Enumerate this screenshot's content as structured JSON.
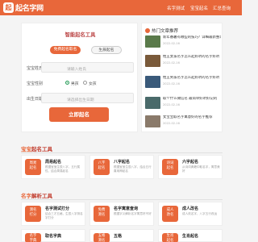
{
  "header": {
    "logo_mark": "起",
    "logo_text": "起名字网",
    "nav": [
      "名字测试",
      "宝宝起名",
      "汇总查询"
    ]
  },
  "form": {
    "title": "智能起名工具",
    "tabs": [
      {
        "label": "免费起名取名",
        "active": true
      },
      {
        "label": "生辰起名",
        "active": false
      }
    ],
    "surname_label": "宝宝姓氏",
    "surname_placeholder": "请输入姓氏",
    "gender_label": "宝宝性别",
    "gender_options": [
      {
        "label": "男孩",
        "selected": true
      },
      {
        "label": "女孩",
        "selected": false
      }
    ],
    "birth_label": "出生日期",
    "birth_placeholder": "请选择出生日期",
    "submit": "立即起名"
  },
  "news": {
    "title": "热门文章推荐",
    "items": [
      {
        "title": "新年番薯有哪些的技巧？详细最新整理",
        "date": "2022-02-16",
        "thumb_color": "#5a7a4a"
      },
      {
        "title": "姓王女孩名字怎么起好听的名字好听",
        "date": "2022-02-16",
        "thumb_color": "#7a5a3a"
      },
      {
        "title": "姓王男孩名字怎么起好听的名字好听",
        "date": "2022-02-16",
        "thumb_color": "#3a5a7a"
      },
      {
        "title": "取个什么微信名 最简单好听好记的",
        "date": "2022-02-16",
        "thumb_color": "#4a6a6a"
      },
      {
        "title": "女宝宝取名字寓意好的名字推荐",
        "date": "2022-02-16",
        "thumb_color": "#8a7a6a"
      }
    ]
  },
  "sections": [
    {
      "title_accent": "宝宝",
      "title_rest": "起名工具",
      "cards": [
        {
          "icon": "周易\n起名",
          "title": "周易起名",
          "desc": "根据宝宝生辰八字，五行属性，结合周易起名",
          "color": "#e8673a"
        },
        {
          "icon": "八字\n起名",
          "title": "八字起名",
          "desc": "根据宝宝生辰八字，结合五行喜用神起名",
          "color": "#e8673a"
        },
        {
          "icon": "诗词\n起名",
          "title": "六字起名",
          "desc": "从诗词典籍中取名字，寓意美好",
          "color": "#e8673a"
        }
      ]
    },
    {
      "title_accent": "名字",
      "title_rest": "解析工具",
      "cards": [
        {
          "icon": "测名\n打分",
          "title": "名字测试打分",
          "desc": "结合三才五格，生辰八字测名字打分",
          "color": "#e8673a"
        },
        {
          "icon": "免费\n测名",
          "title": "名字寓意查询",
          "desc": "根据字义解析名字寓意好不好",
          "color": "#e8673a"
        },
        {
          "icon": "成人\n改名",
          "title": "成人改名",
          "desc": "成人改名字，八字五行改运",
          "color": "#e8673a"
        }
      ]
    },
    {
      "cards": [
        {
          "icon": "名字\n字典",
          "title": "取名字典",
          "desc": "",
          "color": "#e8673a"
        },
        {
          "icon": "五格\n测名",
          "title": "五格",
          "desc": "",
          "color": "#e8673a"
        },
        {
          "icon": "生肖\n起名",
          "title": "生肖起名",
          "desc": "",
          "color": "#e8673a"
        }
      ]
    }
  ]
}
